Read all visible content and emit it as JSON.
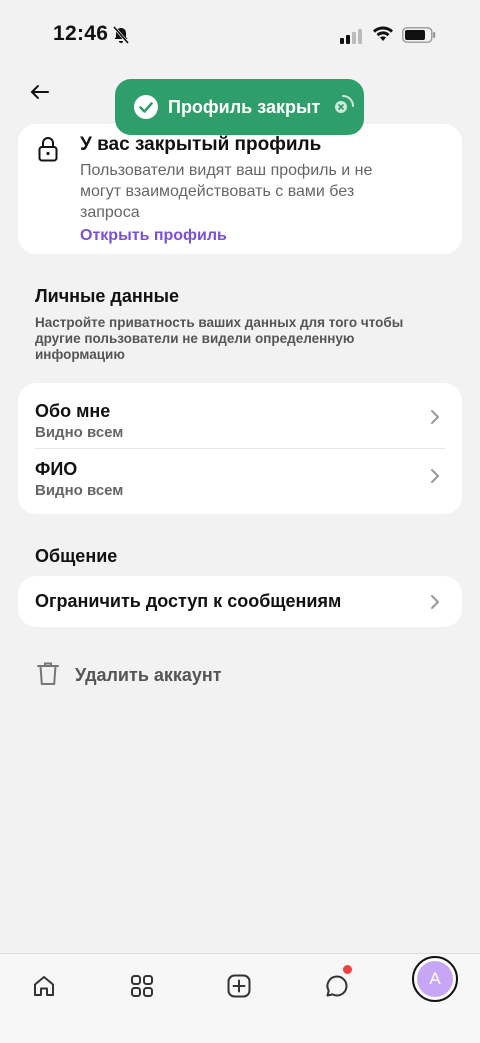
{
  "status_bar": {
    "time": "12:46"
  },
  "toast": {
    "text": "Профиль закрыт"
  },
  "private_card": {
    "title": "У вас закрытый профиль",
    "description": "Пользователи видят ваш профиль и не могут взаимодействовать с вами без запроса",
    "link": "Открыть профиль"
  },
  "personal": {
    "title": "Личные данные",
    "description": "Настройте приватность ваших данных для того чтобы другие пользователи не видели определенную информацию",
    "items": [
      {
        "title": "Обо мне",
        "subtitle": "Видно всем"
      },
      {
        "title": "ФИО",
        "subtitle": "Видно всем"
      }
    ]
  },
  "communication": {
    "title": "Общение",
    "restrict_label": "Ограничить доступ к сообщениям"
  },
  "delete": {
    "label": "Удалить аккаунт"
  },
  "tabbar": {
    "avatar_letter": "A",
    "icons": [
      "home-icon",
      "grid-icon",
      "add-icon",
      "chat-icon",
      "avatar"
    ]
  },
  "colors": {
    "accent": "#7b4fd6",
    "toast": "#2e9e6a",
    "badge": "#f04040",
    "avatar": "#c7a6f5"
  }
}
